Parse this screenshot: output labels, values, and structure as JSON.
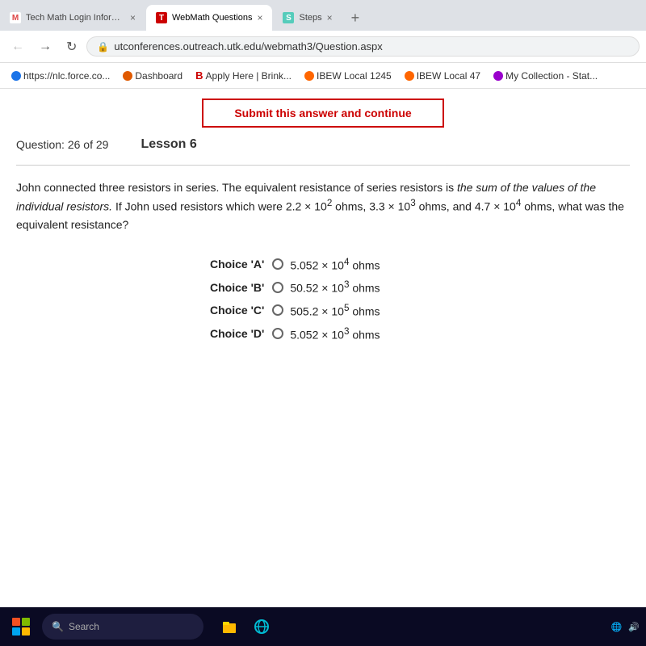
{
  "tabs": [
    {
      "id": "gmail",
      "icon_type": "gmail",
      "icon_label": "M",
      "label": "Tech Math Login Information - d...",
      "active": false
    },
    {
      "id": "webmath",
      "icon_type": "webmath",
      "icon_label": "T",
      "label": "WebMath Questions",
      "active": true
    },
    {
      "id": "steps",
      "icon_type": "steps",
      "icon_label": "S",
      "label": "Steps",
      "active": false
    }
  ],
  "nav": {
    "url": "utconferences.outreach.utk.edu/webmath3/Question.aspx"
  },
  "bookmarks": [
    {
      "label": "https://nlc.force.co...",
      "color": "#1a73e8"
    },
    {
      "label": "Dashboard",
      "color": "#e05a00"
    },
    {
      "label": "Apply Here | Brink...",
      "color": "#cc0000"
    },
    {
      "label": "IBEW Local 1245",
      "color": "#ff6600"
    },
    {
      "label": "IBEW Local 47",
      "color": "#ff6600"
    },
    {
      "label": "My Collection - Stat...",
      "color": "#9900cc"
    }
  ],
  "submit_button": "Submit this answer and continue",
  "question": {
    "label": "Question:",
    "number": "26 of 29",
    "lesson": "Lesson 6",
    "text_parts": [
      "John connected three resistors in series. The equivalent resistance of series resistors is the sum of the values of the individual resistors. If John used resistors which were 2.2 × 10",
      "2",
      " ohms, 3.3 × 10",
      "3",
      " ohms, and 4.7 × 10",
      "4",
      " ohms, what was the equivalent resistance?"
    ]
  },
  "choices": [
    {
      "key": "Choice 'A'",
      "value": "5.052",
      "operator": "×",
      "exp": "4",
      "unit": "ohms"
    },
    {
      "key": "Choice 'B'",
      "value": "50.52",
      "operator": "×",
      "exp": "3",
      "unit": "ohms"
    },
    {
      "key": "Choice 'C'",
      "value": "505.2",
      "operator": "×",
      "exp": "5",
      "unit": "ohms"
    },
    {
      "key": "Choice 'D'",
      "value": "5.052",
      "operator": "×",
      "exp": "3",
      "unit": "ohms"
    }
  ],
  "taskbar": {
    "search_placeholder": "Search"
  }
}
